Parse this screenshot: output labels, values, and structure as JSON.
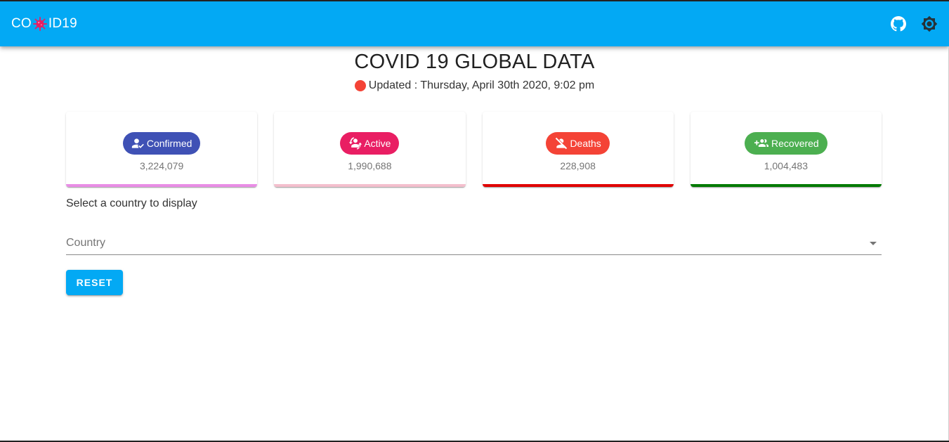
{
  "app": {
    "title_prefix": "CO",
    "title_suffix": "ID19",
    "logo_icon": "virus-icon"
  },
  "header_actions": [
    {
      "icon": "github-icon"
    },
    {
      "icon": "brightness-gear-icon"
    }
  ],
  "page": {
    "heading": "COVID 19 GLOBAL DATA",
    "updated": "Updated : Thursday, April 30th 2020, 9:02 pm"
  },
  "stats": [
    {
      "label": "Confirmed",
      "value": "3,224,079",
      "icon": "person-check-icon",
      "chip_color": "#3f51b5",
      "bar_color": "#e98de6"
    },
    {
      "label": "Active",
      "value": "1,990,688",
      "icon": "person-sync-icon",
      "chip_color": "#e91e63",
      "bar_color": "#f4bfcd"
    },
    {
      "label": "Deaths",
      "value": "228,908",
      "icon": "person-off-icon",
      "chip_color": "#f44336",
      "bar_color": "#e00000"
    },
    {
      "label": "Recovered",
      "value": "1,004,483",
      "icon": "group-add-icon",
      "chip_color": "#4caf50",
      "bar_color": "#007a00"
    }
  ],
  "country_select": {
    "label": "Select a country to display",
    "placeholder": "Country"
  },
  "reset_button": {
    "label": "RESET"
  },
  "colors": {
    "appbar": "#03a9f4",
    "live_dot": "#f44336"
  }
}
